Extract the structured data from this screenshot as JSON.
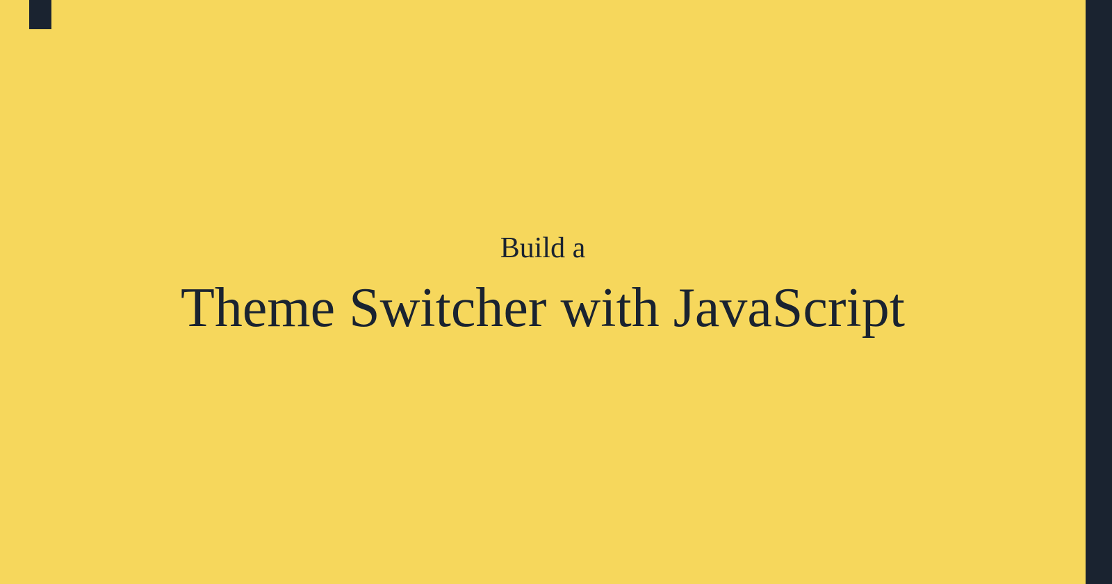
{
  "slide": {
    "subtitle": "Build a",
    "title": "Theme Switcher with JavaScript"
  },
  "colors": {
    "background": "#f6d75c",
    "accent": "#1a2330",
    "text": "#1a2330"
  }
}
